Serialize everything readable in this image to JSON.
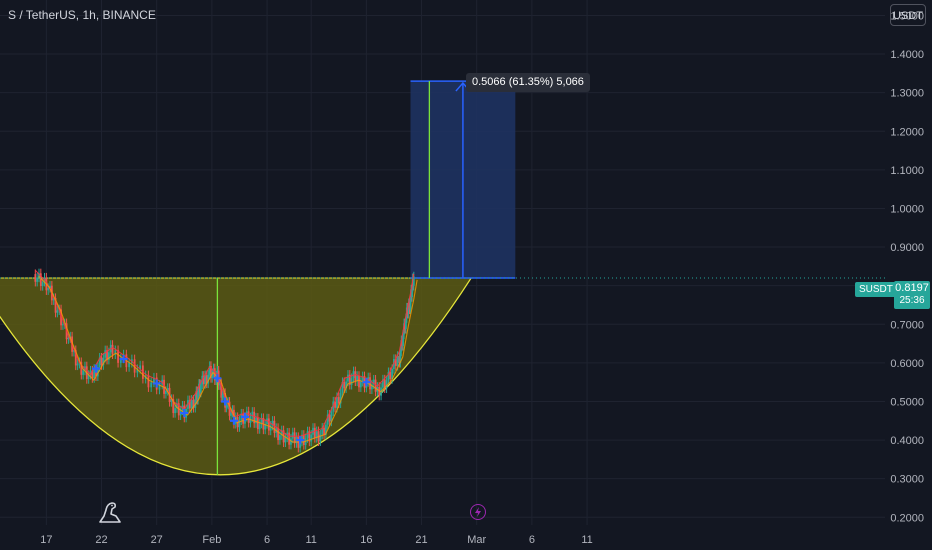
{
  "header": {
    "symbol_title": "S / TetherUS, 1h, BINANCE"
  },
  "currency_button": "USDT",
  "price_tag": {
    "symbol": "SUSDT",
    "value": "0.8197",
    "timer": "25:36"
  },
  "measure_tooltip": "0.5066 (61.35%) 5,066",
  "colors": {
    "background": "#131722",
    "grid": "#1f2330",
    "bowl_fill": "#5c5a13",
    "bowl_stroke": "#e6e63a",
    "measure_fill": "#1e3260",
    "measure_line": "#2962ff",
    "green_line": "#7ae33b",
    "up_candle": "#26a69a",
    "down_candle": "#ef5350",
    "ma_red": "#f23645",
    "ma_orange": "#ff9800",
    "marker": "#2962ff",
    "price_line": "#26a69a"
  },
  "icons": {
    "logo": "tradingview-dinosaur-icon",
    "flash": "lightning-icon"
  },
  "chart_data": {
    "type": "candlestick",
    "symbol": "S / TetherUS",
    "interval": "1h",
    "exchange": "BINANCE",
    "y_ticks": [
      0.2,
      0.3,
      0.4,
      0.5,
      0.6,
      0.7,
      0.8,
      0.9,
      1.0,
      1.1,
      1.2,
      1.3,
      1.4,
      1.5
    ],
    "y_tick_labels": [
      "0.2000",
      "0.3000",
      "0.4000",
      "0.5000",
      "0.6000",
      "0.7000",
      "0.8000",
      "0.9000",
      "1.0000",
      "1.1000",
      "1.2000",
      "1.3000",
      "1.4000",
      "1.5000"
    ],
    "ylim": [
      0.18,
      1.54
    ],
    "x_ticks": [
      17,
      22,
      27,
      32,
      37,
      41,
      46,
      51,
      56,
      61,
      66
    ],
    "x_tick_labels": [
      "17",
      "22",
      "27",
      "Feb",
      "6",
      "11",
      "16",
      "21",
      "Mar",
      "6",
      "11"
    ],
    "xlim": [
      12.8,
      93
    ],
    "last_price": 0.8197,
    "price_path": [
      [
        16.0,
        0.83
      ],
      [
        17.0,
        0.8
      ],
      [
        18.0,
        0.74
      ],
      [
        19.0,
        0.66
      ],
      [
        20.0,
        0.59
      ],
      [
        21.0,
        0.56
      ],
      [
        22.0,
        0.61
      ],
      [
        23.0,
        0.63
      ],
      [
        24.5,
        0.6
      ],
      [
        26.0,
        0.56
      ],
      [
        27.5,
        0.54
      ],
      [
        28.5,
        0.49
      ],
      [
        29.5,
        0.47
      ],
      [
        30.5,
        0.51
      ],
      [
        31.0,
        0.54
      ],
      [
        31.8,
        0.58
      ],
      [
        32.5,
        0.56
      ],
      [
        33.2,
        0.5
      ],
      [
        34.0,
        0.45
      ],
      [
        35.0,
        0.46
      ],
      [
        36.0,
        0.45
      ],
      [
        37.0,
        0.44
      ],
      [
        38.0,
        0.42
      ],
      [
        39.0,
        0.4
      ],
      [
        40.0,
        0.4
      ],
      [
        41.0,
        0.41
      ],
      [
        42.0,
        0.42
      ],
      [
        43.0,
        0.48
      ],
      [
        44.0,
        0.55
      ],
      [
        45.0,
        0.56
      ],
      [
        46.0,
        0.55
      ],
      [
        47.0,
        0.53
      ],
      [
        48.0,
        0.56
      ],
      [
        49.0,
        0.62
      ],
      [
        49.5,
        0.7
      ],
      [
        50.0,
        0.77
      ],
      [
        50.3,
        0.82
      ]
    ],
    "cup_pattern": {
      "rim_price": 0.82,
      "bottom_price": 0.31,
      "x_left": 10.5,
      "x_right": 55.5,
      "x_mid": 32.5
    },
    "measure": {
      "from_price": 0.82,
      "to_price": 1.33,
      "x_start": 50.0,
      "x_end": 59.5,
      "change": 0.5066,
      "change_pct": 61.35,
      "ticks": 5066
    },
    "markers": [
      21.5,
      24.0,
      27.0,
      29.5,
      32.5,
      33.2,
      34.0,
      35.0,
      40.0,
      46.0
    ]
  }
}
